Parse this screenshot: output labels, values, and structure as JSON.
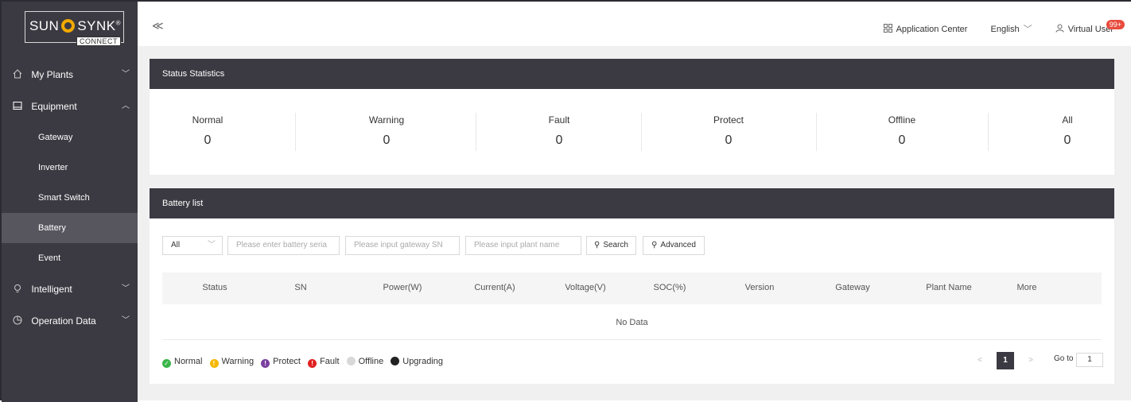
{
  "brand": {
    "name_left": "SUN",
    "name_right": "SYNK",
    "reg": "®",
    "sub": "CONNECT"
  },
  "sidebar": {
    "items": [
      {
        "label": "My Plants",
        "icon": "home-icon",
        "chevron": "﹀"
      },
      {
        "label": "Equipment",
        "icon": "monitor-icon",
        "chevron": "︿"
      },
      {
        "label": "Gateway"
      },
      {
        "label": "Inverter"
      },
      {
        "label": "Smart Switch"
      },
      {
        "label": "Battery",
        "active": true
      },
      {
        "label": "Event"
      },
      {
        "label": "Intelligent",
        "icon": "bulb-icon",
        "chevron": "﹀"
      },
      {
        "label": "Operation Data",
        "icon": "chart-icon",
        "chevron": "﹀"
      }
    ]
  },
  "topbar": {
    "collapse": "≪",
    "app_center": "Application Center",
    "language": "English",
    "user": "Virtual User",
    "badge": "99+"
  },
  "status_panel": {
    "title": "Status Statistics",
    "stats": [
      {
        "label": "Normal",
        "value": "0"
      },
      {
        "label": "Warning",
        "value": "0"
      },
      {
        "label": "Fault",
        "value": "0"
      },
      {
        "label": "Protect",
        "value": "0"
      },
      {
        "label": "Offline",
        "value": "0"
      },
      {
        "label": "All",
        "value": "0"
      }
    ]
  },
  "battery_panel": {
    "title": "Battery list",
    "filters": {
      "status_select": "All",
      "battery_sn_placeholder": "Please enter battery seria",
      "gateway_sn_placeholder": "Please input gateway SN",
      "plant_name_placeholder": "Please input plant name",
      "search_label": "Search",
      "advanced_label": "Advanced"
    },
    "columns": [
      "Status",
      "SN",
      "Power(W)",
      "Current(A)",
      "Voltage(V)",
      "SOC(%)",
      "Version",
      "Gateway",
      "Plant Name",
      "More"
    ],
    "empty_text": "No Data",
    "legend": [
      {
        "label": "Normal",
        "color": "#3ab54a",
        "glyph": "✓"
      },
      {
        "label": "Warning",
        "color": "#f5b800",
        "glyph": "!"
      },
      {
        "label": "Protect",
        "color": "#7b3fa0",
        "glyph": "!"
      },
      {
        "label": "Fault",
        "color": "#e02020",
        "glyph": "!"
      },
      {
        "label": "Offline",
        "color": "#d8d8d8",
        "glyph": ""
      },
      {
        "label": "Upgrading",
        "color": "#222222",
        "glyph": ""
      }
    ],
    "pagination": {
      "prev": "<",
      "current": "1",
      "next": ">",
      "goto_label": "Go to",
      "goto_value": "1"
    }
  }
}
